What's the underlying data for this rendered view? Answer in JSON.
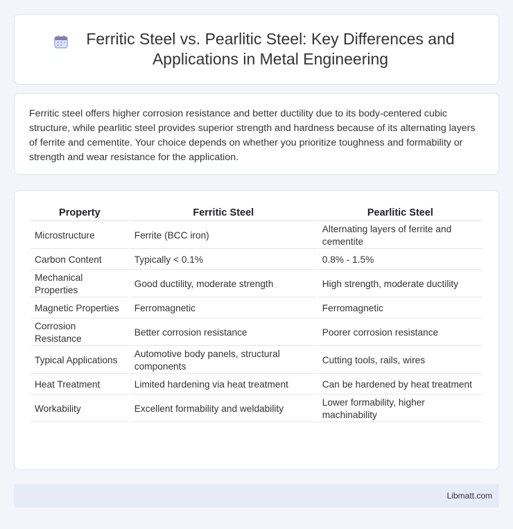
{
  "header": {
    "title": "Ferritic Steel vs. Pearlitic Steel: Key Differences and Applications in Metal Engineering",
    "icon": "calendar-icon"
  },
  "summary": {
    "text": "Ferritic steel offers higher corrosion resistance and better ductility due to its body-centered cubic structure, while pearlitic steel provides superior strength and hardness because of its alternating layers of ferrite and cementite. Your choice depends on whether you prioritize toughness and formability or strength and wear resistance for the application."
  },
  "table": {
    "headers": [
      "Property",
      "Ferritic Steel",
      "Pearlitic Steel"
    ],
    "rows": [
      [
        "Microstructure",
        "Ferrite (BCC iron)",
        "Alternating layers of ferrite and cementite"
      ],
      [
        "Carbon Content",
        "Typically < 0.1%",
        "0.8% - 1.5%"
      ],
      [
        "Mechanical Properties",
        "Good ductility, moderate strength",
        "High strength, moderate ductility"
      ],
      [
        "Magnetic Properties",
        "Ferromagnetic",
        "Ferromagnetic"
      ],
      [
        "Corrosion Resistance",
        "Better corrosion resistance",
        "Poorer corrosion resistance"
      ],
      [
        "Typical Applications",
        "Automotive body panels, structural components",
        "Cutting tools, rails, wires"
      ],
      [
        "Heat Treatment",
        "Limited hardening via heat treatment",
        "Can be hardened by heat treatment"
      ],
      [
        "Workability",
        "Excellent formability and weldability",
        "Lower formability, higher machinability"
      ]
    ]
  },
  "footer": {
    "site": "Libmatt.com"
  },
  "colors": {
    "background": "#f3f5fa",
    "footer_bg": "#e6ebf6",
    "icon_accent": "#6b7fd7"
  }
}
